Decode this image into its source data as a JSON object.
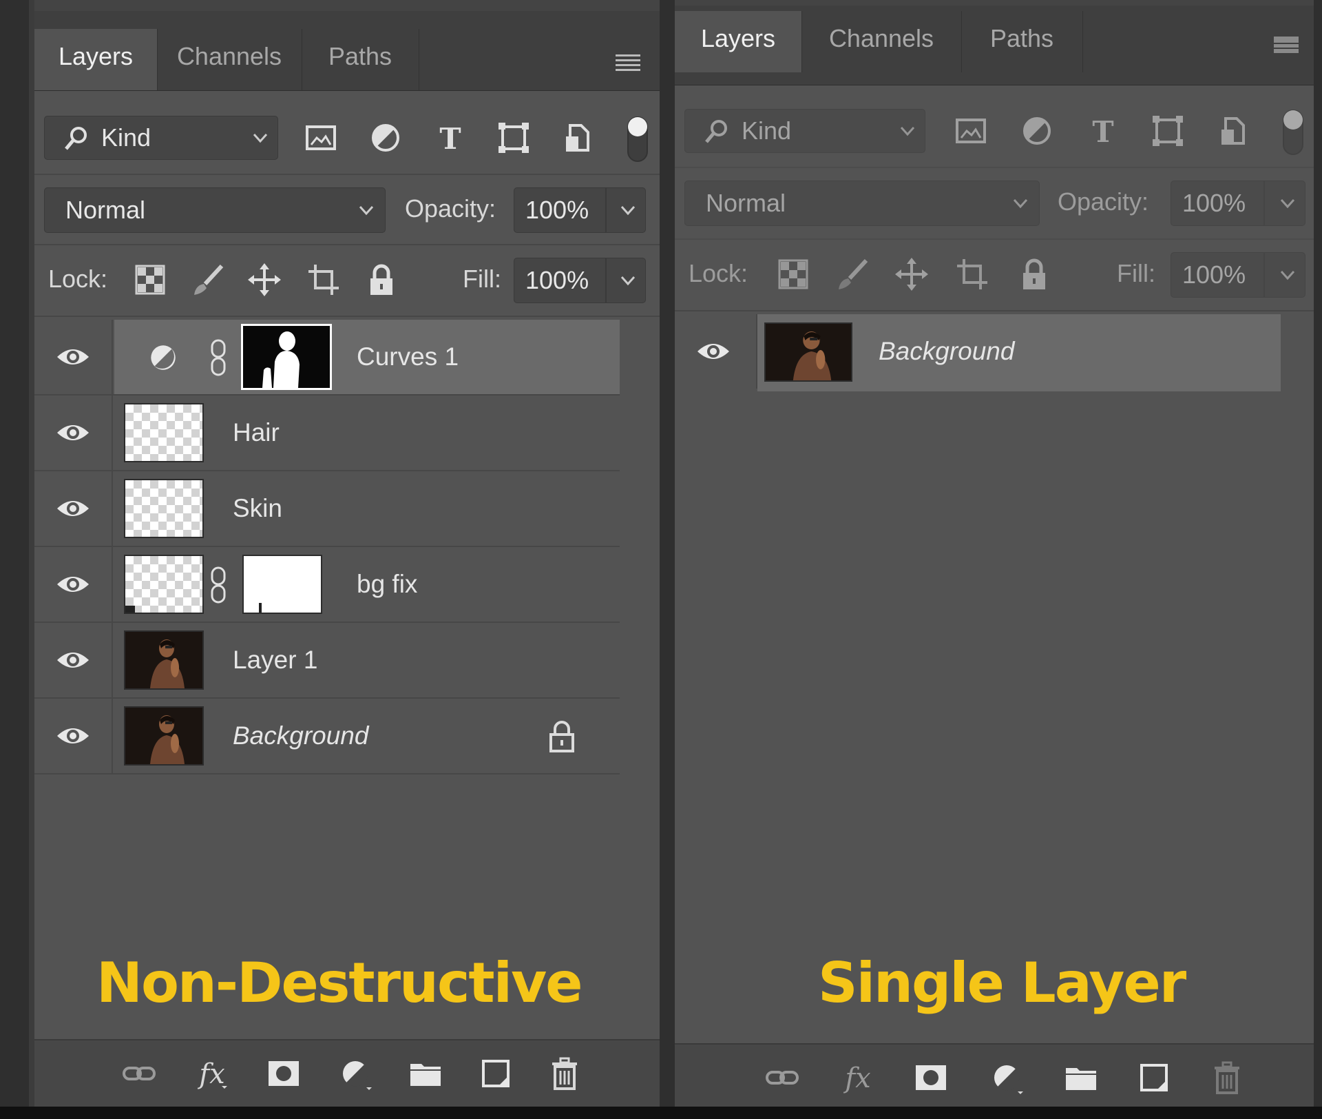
{
  "left_panel": {
    "tabs": [
      {
        "label": "Layers"
      },
      {
        "label": "Channels"
      },
      {
        "label": "Paths"
      }
    ],
    "filter": {
      "label": "Kind"
    },
    "blend_mode": "Normal",
    "opacity_label": "Opacity:",
    "opacity_value": "100%",
    "lock_label": "Lock:",
    "fill_label": "Fill:",
    "fill_value": "100%",
    "layers": [
      {
        "name": "Curves 1",
        "selected": true
      },
      {
        "name": "Hair"
      },
      {
        "name": "Skin"
      },
      {
        "name": "bg fix"
      },
      {
        "name": "Layer 1"
      },
      {
        "name": "Background",
        "italic": true,
        "locked": true
      }
    ],
    "caption": "Non-Destructive"
  },
  "right_panel": {
    "tabs": [
      {
        "label": "Layers"
      },
      {
        "label": "Channels"
      },
      {
        "label": "Paths"
      }
    ],
    "filter": {
      "label": "Kind"
    },
    "blend_mode": "Normal",
    "opacity_label": "Opacity:",
    "opacity_value": "100%",
    "lock_label": "Lock:",
    "fill_label": "Fill:",
    "fill_value": "100%",
    "layers": [
      {
        "name": "Background",
        "italic": true,
        "selected": true
      }
    ],
    "caption": "Single Layer"
  },
  "colors": {
    "panel_bg": "#535353",
    "selected_row": "#6a6a6a",
    "caption": "#f5c518"
  },
  "icons": [
    "search-icon",
    "chevron-down-icon",
    "pixel-filter-icon",
    "adjustment-filter-icon",
    "type-filter-icon",
    "shape-filter-icon",
    "smart-object-filter-icon",
    "filter-toggle-icon",
    "lock-transparent-icon",
    "lock-brush-icon",
    "lock-move-icon",
    "lock-artboard-icon",
    "lock-all-icon",
    "eye-icon",
    "chain-link-icon",
    "link-layers-icon",
    "fx-icon",
    "mask-icon",
    "new-adjustment-icon",
    "folder-icon",
    "new-layer-icon",
    "trash-icon",
    "panel-menu-icon"
  ]
}
